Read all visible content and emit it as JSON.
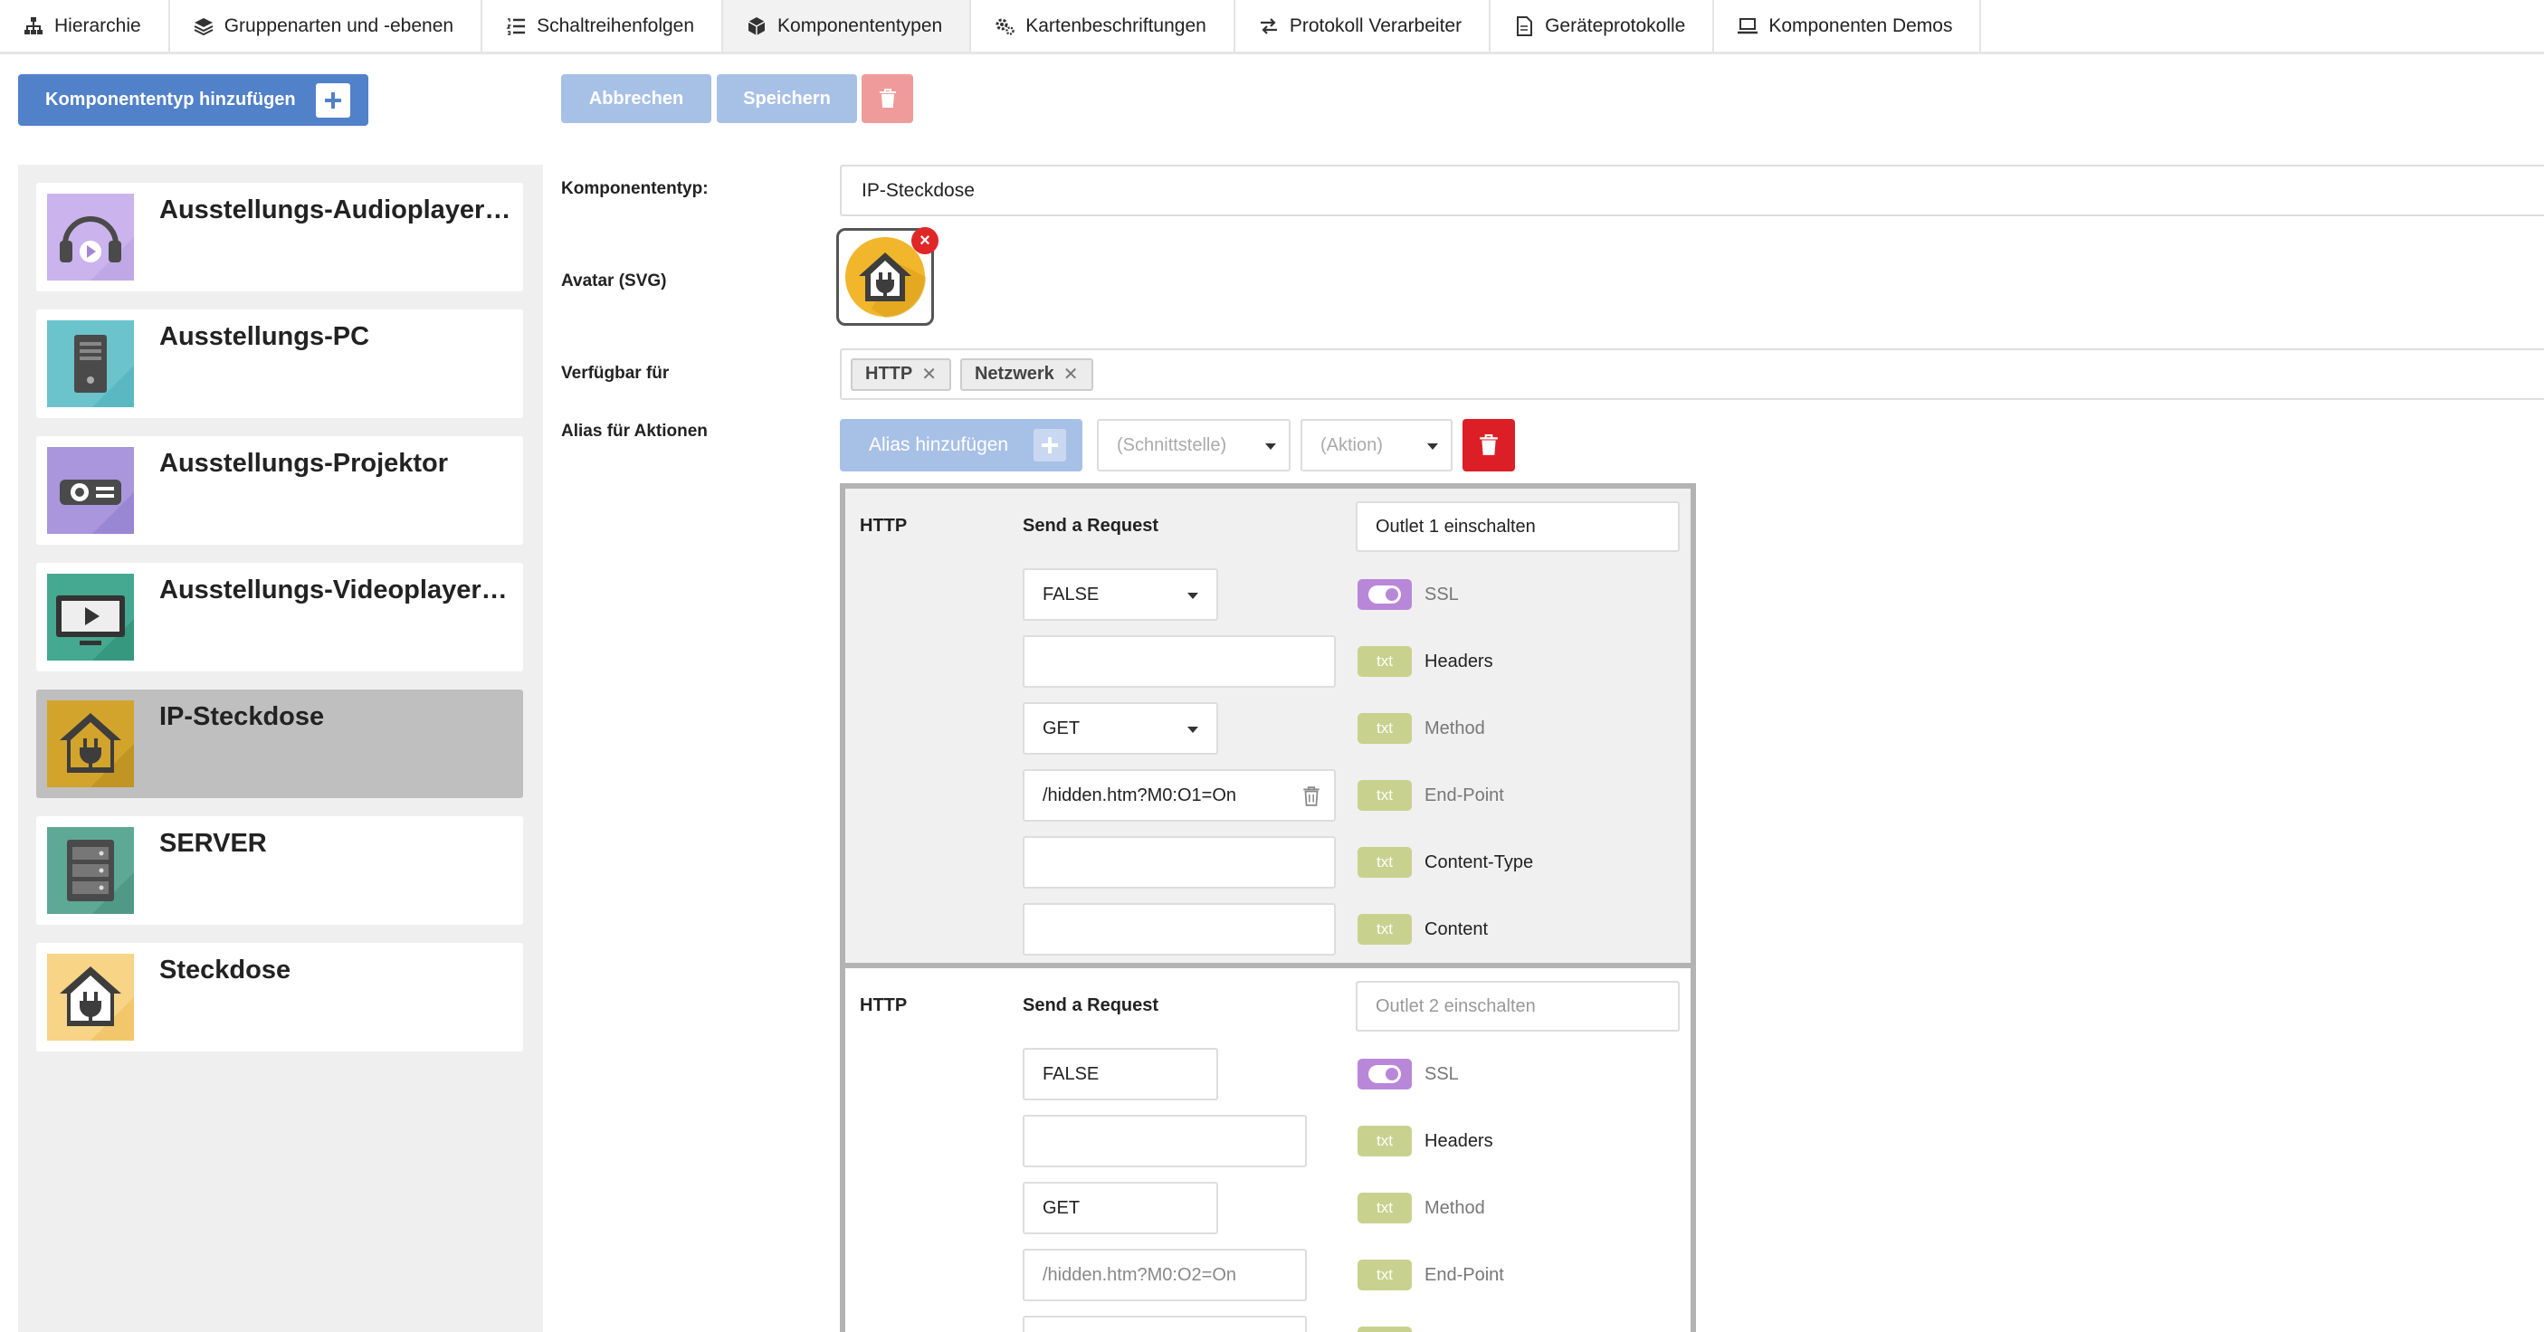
{
  "nav": {
    "tabs": [
      {
        "label": "Hierarchie",
        "icon": "sitemap-icon"
      },
      {
        "label": "Gruppenarten und -ebenen",
        "icon": "layers-icon"
      },
      {
        "label": "Schaltreihenfolgen",
        "icon": "ordered-list-icon"
      },
      {
        "label": "Komponententypen",
        "icon": "cube-icon",
        "active": true
      },
      {
        "label": "Kartenbeschriftungen",
        "icon": "gears-icon"
      },
      {
        "label": "Protokoll Verarbeiter",
        "icon": "exchange-icon"
      },
      {
        "label": "Geräteprotokolle",
        "icon": "document-icon"
      },
      {
        "label": "Komponenten Demos",
        "icon": "laptop-icon"
      }
    ]
  },
  "toolbar": {
    "add_label": "Komponententyp hinzufügen",
    "cancel_label": "Abbrechen",
    "save_label": "Speichern"
  },
  "sidebar": {
    "items": [
      {
        "name": "Ausstellungs-Audioplayer -Brig...",
        "icon": "headphones-icon",
        "color": "#cbb3ee"
      },
      {
        "name": "Ausstellungs-PC",
        "icon": "computer-tower-icon",
        "color": "#6bc3cc"
      },
      {
        "name": "Ausstellungs-Projektor",
        "icon": "projector-icon",
        "color": "#a996dc"
      },
      {
        "name": "Ausstellungs-Videoplayer - Brig...",
        "icon": "monitor-play-icon",
        "color": "#45a890"
      },
      {
        "name": "IP-Steckdose",
        "icon": "house-plug-icon",
        "color": "#d3a42c",
        "selected": true
      },
      {
        "name": "SERVER",
        "icon": "server-rack-icon",
        "color": "#5ea896"
      },
      {
        "name": "Steckdose",
        "icon": "house-plug-icon",
        "color": "#f7d486"
      }
    ]
  },
  "form": {
    "type_label": "Komponententyp:",
    "type_value": "IP-Steckdose",
    "avatar_label": "Avatar (SVG)",
    "available_label": "Verfügbar für",
    "available_tags": [
      "HTTP",
      "Netzwerk"
    ],
    "alias_label": "Alias für Aktionen",
    "alias_add_label": "Alias hinzufügen",
    "interface_placeholder": "(Schnittstelle)",
    "action_placeholder": "(Aktion)"
  },
  "aliases": [
    {
      "protocol": "HTTP",
      "action": "Send a Request",
      "alias": "Outlet 1 einschalten",
      "ssl_value": "FALSE",
      "headers_value": "",
      "method_value": "GET",
      "endpoint_value": "/hidden.htm?M0:O1=On",
      "content_type_value": "",
      "content_value": "",
      "param_labels": [
        "SSL",
        "Headers",
        "Method",
        "End-Point",
        "Content-Type",
        "Content"
      ],
      "badge_text": "txt"
    },
    {
      "protocol": "HTTP",
      "action": "Send a Request",
      "alias": "Outlet 2 einschalten",
      "ssl_value": "FALSE",
      "headers_value": "",
      "method_value": "GET",
      "endpoint_value": "/hidden.htm?M0:O2=On",
      "param_labels": [
        "SSL",
        "Headers",
        "Method",
        "End-Point"
      ],
      "badge_text": "txt"
    }
  ],
  "colors": {
    "primary": "#5181c9",
    "primary_disabled": "#a7c0e6",
    "danger": "#dc1f26",
    "danger_disabled": "#f09b9b",
    "toggle": "#b987d8",
    "txt_badge": "#c8d28e"
  }
}
